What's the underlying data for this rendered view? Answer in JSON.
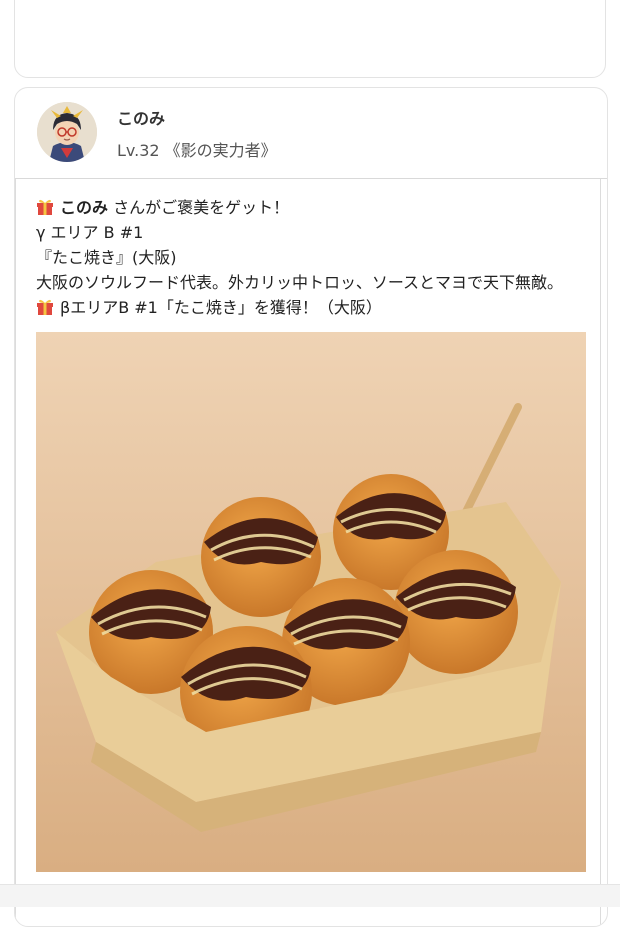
{
  "post": {
    "username": "このみ",
    "level": "Lv.32 《影の実力者》",
    "message": {
      "line1_name": "このみ",
      "line1_rest": " さんがご褒美をゲット！",
      "line2": "γ エリア B #1",
      "line3": "『たこ焼き』(大阪)",
      "line4": "大阪のソウルフード代表。外カリッ中トロッ、ソースとマヨで天下無敵。",
      "line5": "βエリアB #1「たこ焼き」を獲得！（大阪）"
    },
    "icons": [
      "gift-icon",
      "avatar-image",
      "takoyaki-photo"
    ]
  }
}
